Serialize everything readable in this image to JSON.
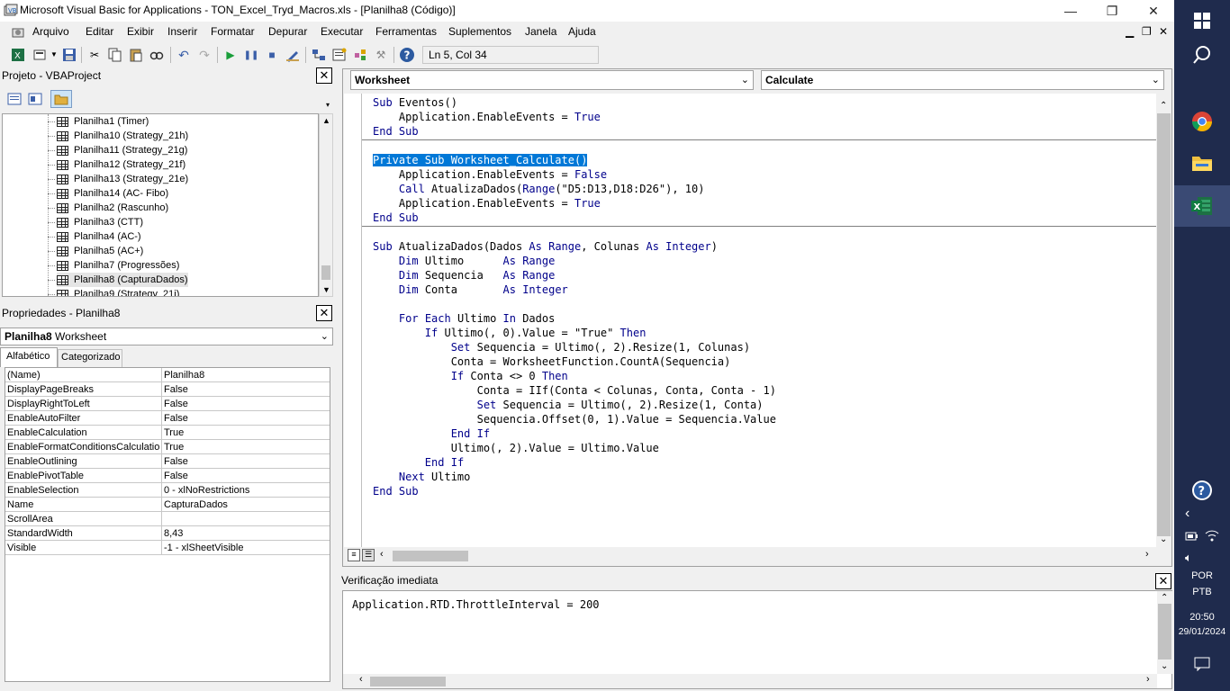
{
  "window": {
    "title": "Microsoft Visual Basic for Applications - TON_Excel_Tryd_Macros.xls - [Planilha8 (Código)]"
  },
  "menu": [
    "Arquivo",
    "Editar",
    "Exibir",
    "Inserir",
    "Formatar",
    "Depurar",
    "Executar",
    "Ferramentas",
    "Suplementos",
    "Janela",
    "Ajuda"
  ],
  "toolbar": {
    "position": "Ln 5, Col 34"
  },
  "project": {
    "title": "Projeto - VBAProject",
    "items": [
      "Planilha1 (Timer)",
      "Planilha10 (Strategy_21h)",
      "Planilha11 (Strategy_21g)",
      "Planilha12 (Strategy_21f)",
      "Planilha13 (Strategy_21e)",
      "Planilha14 (AC- Fibo)",
      "Planilha2 (Rascunho)",
      "Planilha3 (CTT)",
      "Planilha4 (AC-)",
      "Planilha5 (AC+)",
      "Planilha7 (Progressões)",
      "Planilha8 (CapturaDados)",
      "Planilha9 (Strategy_21i)"
    ]
  },
  "properties": {
    "title": "Propriedades - Planilha8",
    "object_name": "Planilha8",
    "object_type": "Worksheet",
    "tabs": [
      "Alfabético",
      "Categorizado"
    ],
    "rows": [
      {
        "k": "(Name)",
        "v": "Planilha8"
      },
      {
        "k": "DisplayPageBreaks",
        "v": "False"
      },
      {
        "k": "DisplayRightToLeft",
        "v": "False"
      },
      {
        "k": "EnableAutoFilter",
        "v": "False"
      },
      {
        "k": "EnableCalculation",
        "v": "True"
      },
      {
        "k": "EnableFormatConditionsCalculation",
        "v": "True"
      },
      {
        "k": "EnableOutlining",
        "v": "False"
      },
      {
        "k": "EnablePivotTable",
        "v": "False"
      },
      {
        "k": "EnableSelection",
        "v": "0 - xlNoRestrictions"
      },
      {
        "k": "Name",
        "v": "CapturaDados"
      },
      {
        "k": "ScrollArea",
        "v": ""
      },
      {
        "k": "StandardWidth",
        "v": "8,43"
      },
      {
        "k": "Visible",
        "v": "-1 - xlSheetVisible"
      }
    ]
  },
  "code": {
    "object_combo": "Worksheet",
    "proc_combo": "Calculate",
    "lines": [
      "Sub Eventos()",
      "    Application.EnableEvents = True",
      "End Sub",
      "",
      "Private Sub Worksheet_Calculate()",
      "    Application.EnableEvents = False",
      "    Call AtualizaDados(Range(\"D5:D13,D18:D26\"), 10)",
      "    Application.EnableEvents = True",
      "End Sub",
      "",
      "Sub AtualizaDados(Dados As Range, Colunas As Integer)",
      "    Dim Ultimo      As Range",
      "    Dim Sequencia   As Range",
      "    Dim Conta       As Integer",
      "",
      "    For Each Ultimo In Dados",
      "        If Ultimo(, 0).Value = \"True\" Then",
      "            Set Sequencia = Ultimo(, 2).Resize(1, Colunas)",
      "            Conta = WorksheetFunction.CountA(Sequencia)",
      "            If Conta <> 0 Then",
      "                Conta = IIf(Conta < Colunas, Conta, Conta - 1)",
      "                Set Sequencia = Ultimo(, 2).Resize(1, Conta)",
      "                Sequencia.Offset(0, 1).Value = Sequencia.Value",
      "            End If",
      "            Ultimo(, 2).Value = Ultimo.Value",
      "        End If",
      "    Next Ultimo",
      "End Sub"
    ]
  },
  "immediate": {
    "title": "Verificação imediata",
    "text": "Application.RTD.ThrottleInterval = 200"
  },
  "taskbar": {
    "language": "POR",
    "layout": "PTB",
    "time": "20:50",
    "date": "29/01/2024"
  }
}
